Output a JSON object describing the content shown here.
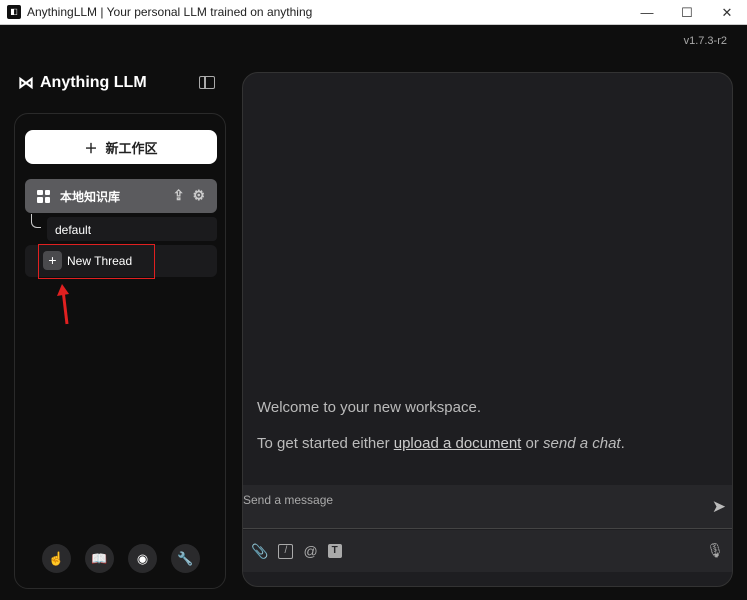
{
  "window": {
    "title": "AnythingLLM | Your personal LLM trained on anything",
    "minimize": "—",
    "maximize": "☐",
    "close": "✕"
  },
  "version": "v1.7.3-r2",
  "logo": "Anything LLM",
  "sidebar": {
    "new_workspace": "新工作区",
    "workspace": "本地知识库",
    "thread": "default",
    "new_thread": "New Thread"
  },
  "main": {
    "welcome": "Welcome to your new workspace.",
    "started_prefix": "To get started either ",
    "upload_link": "upload a document",
    "or": " or ",
    "send_chat": "send a chat",
    "period": ".",
    "placeholder": "Send a message"
  },
  "colors": {
    "highlight": "#e02020",
    "accent": "#ffffff"
  }
}
